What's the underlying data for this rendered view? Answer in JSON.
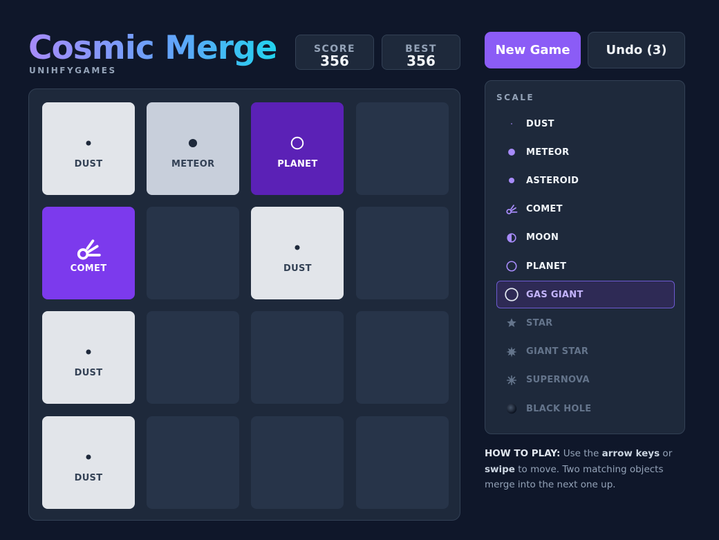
{
  "header": {
    "title": "Cosmic Merge",
    "subtitle": "UNIHFYGAMES"
  },
  "scores": {
    "score_label": "SCORE",
    "score_value": "356",
    "best_label": "BEST",
    "best_value": "356"
  },
  "buttons": {
    "new_game": "New Game",
    "undo": "Undo (3)"
  },
  "colors": {
    "accent": "#8b5cf6",
    "background": "#0f172a",
    "tile_dust": "#e2e5ea",
    "tile_meteor": "#c8cfdb",
    "tile_planet": "#5b21b6",
    "tile_comet": "#7c3aed"
  },
  "board": {
    "size": 4,
    "tiles": [
      {
        "row": 0,
        "col": 0,
        "label": "DUST",
        "icon": "dust-icon"
      },
      {
        "row": 0,
        "col": 1,
        "label": "METEOR",
        "icon": "meteor-icon"
      },
      {
        "row": 0,
        "col": 2,
        "label": "PLANET",
        "icon": "planet-icon"
      },
      {
        "row": 1,
        "col": 0,
        "label": "COMET",
        "icon": "comet-icon"
      },
      {
        "row": 1,
        "col": 2,
        "label": "DUST",
        "icon": "dust-icon"
      },
      {
        "row": 2,
        "col": 0,
        "label": "DUST",
        "icon": "dust-icon"
      },
      {
        "row": 3,
        "col": 0,
        "label": "DUST",
        "icon": "dust-icon"
      }
    ]
  },
  "scale": {
    "title": "SCALE",
    "items": [
      {
        "label": "DUST",
        "icon": "dust-icon",
        "state": "unlocked"
      },
      {
        "label": "METEOR",
        "icon": "meteor-icon",
        "state": "unlocked"
      },
      {
        "label": "ASTEROID",
        "icon": "asteroid-icon",
        "state": "unlocked"
      },
      {
        "label": "COMET",
        "icon": "comet-icon",
        "state": "unlocked"
      },
      {
        "label": "MOON",
        "icon": "moon-icon",
        "state": "unlocked"
      },
      {
        "label": "PLANET",
        "icon": "planet-icon",
        "state": "unlocked"
      },
      {
        "label": "GAS GIANT",
        "icon": "gas-giant-icon",
        "state": "current"
      },
      {
        "label": "STAR",
        "icon": "star-icon",
        "state": "locked"
      },
      {
        "label": "GIANT STAR",
        "icon": "giant-star-icon",
        "state": "locked"
      },
      {
        "label": "SUPERNOVA",
        "icon": "supernova-icon",
        "state": "locked"
      },
      {
        "label": "BLACK HOLE",
        "icon": "black-hole-icon",
        "state": "locked"
      }
    ]
  },
  "howto": {
    "heading": "HOW TO PLAY:",
    "t1": " Use the ",
    "k1": "arrow keys",
    "t2": " or ",
    "k2": "swipe",
    "t3": " to move. Two matching objects merge into the next one up."
  }
}
